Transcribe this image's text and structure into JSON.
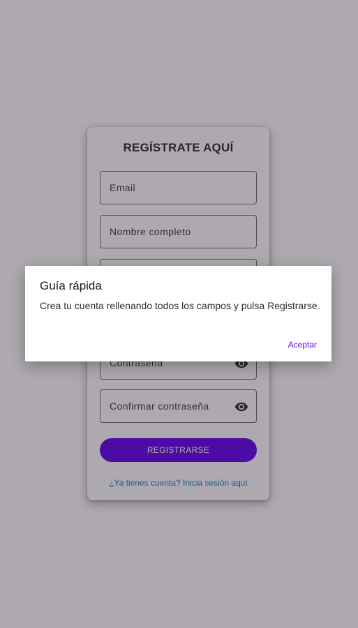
{
  "register": {
    "title": "REGÍSTRATE AQUÍ",
    "fields": [
      {
        "placeholder": "Email"
      },
      {
        "placeholder": "Nombre completo"
      },
      {
        "placeholder": ""
      },
      {
        "placeholder": ""
      },
      {
        "placeholder": "Contraseña",
        "icon": "eye-icon"
      },
      {
        "placeholder": "Confirmar contraseña",
        "icon": "eye-icon"
      }
    ],
    "register_button": "REGISTRARSE",
    "login_link": "¿Ya tienes cuenta? Inicia sesión aquí"
  },
  "dialog": {
    "title": "Guía rápida",
    "message": "Crea tu cuenta rellenando todos los campos y pulsa Registrarse.",
    "accept_label": "Aceptar"
  },
  "colors": {
    "accent": "#6200ee",
    "link": "#0a84c6",
    "scrim": "#281c2e"
  }
}
